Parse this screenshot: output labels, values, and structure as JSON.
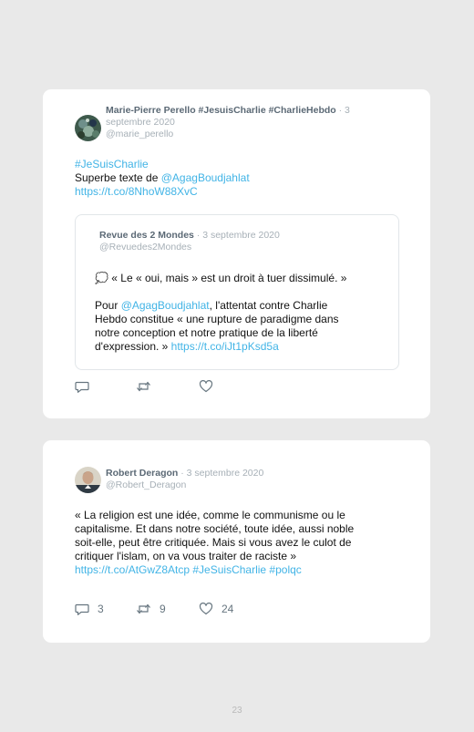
{
  "tweets": [
    {
      "author": "Marie-Pierre Perello #JesuisCharlie #CharlieHebdo",
      "date": "· 3 septembre 2020",
      "handle": "@marie_perello",
      "text": {
        "hashtag": "#JeSuisCharlie",
        "line2_prefix": "Superbe texte de ",
        "mention": "@AgagBoudjahlat",
        "url": "https://t.co/8NhoW88XvC"
      },
      "quoted": {
        "author": "Revue des 2 Mondes",
        "date": "· 3 septembre 2020",
        "handle": "@Revuedes2Mondes",
        "line1": "💭 « Le « oui, mais » est un droit à tuer dissimulé. »",
        "pour": "Pour ",
        "mention": "@AgagBoudjahlat",
        "rest1": ", l'attentat contre Charlie",
        "rest2": "Hebdo constitue « une rupture de paradigme dans",
        "rest3": "notre conception et notre pratique de la liberté",
        "rest4": "d'expression. » ",
        "url": "https://t.co/iJt1pKsd5a"
      },
      "replies": "",
      "retweets": "",
      "likes": ""
    },
    {
      "author": "Robert Deragon",
      "date": "· 3 septembre 2020",
      "handle": "@Robert_Deragon",
      "text": {
        "line1": "« La religion est une idée, comme le communisme ou le",
        "line2": "capitalisme. Et dans notre société, toute idée, aussi noble",
        "line3": "soit-elle, peut être critiquée. Mais si vous avez le culot de",
        "line4": "critiquer l'islam, on va vous traiter de raciste »",
        "url_line": "https://t.co/AtGwZ8Atcp #JeSuisCharlie #polqc"
      },
      "replies": "3",
      "retweets": "9",
      "likes": "24"
    }
  ],
  "page_number": "23",
  "icons": {
    "reply": "reply-icon",
    "retweet": "retweet-icon",
    "like": "heart-icon"
  },
  "colors": {
    "link": "#42b4e6",
    "name": "#5b6975",
    "meta": "#a7b0b7",
    "background": "#e9e9e9"
  }
}
